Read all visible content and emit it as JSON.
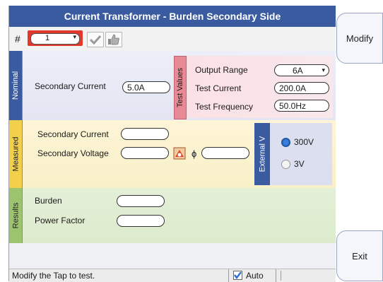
{
  "window": {
    "title": "Current Transformer - Burden Secondary Side"
  },
  "toolbar": {
    "hash_label": "#",
    "tap_value": "1",
    "tap_dropdown_glyph": "▾",
    "check_icon": "check-icon",
    "thumb_icon": "thumbs-up-icon"
  },
  "nominal": {
    "tab_label": "Nominal",
    "secondary_current_label": "Secondary Current",
    "secondary_current_value": "5.0A",
    "test_values": {
      "tab_label": "Test Values",
      "output_range_label": "Output Range",
      "output_range_value": "6A",
      "test_current_label": "Test Current",
      "test_current_value": "200.0A",
      "test_frequency_label": "Test Frequency",
      "test_frequency_value": "50.0Hz"
    }
  },
  "measured": {
    "tab_label": "Measured",
    "secondary_current_label": "Secondary Current",
    "secondary_current_value": "",
    "secondary_voltage_label": "Secondary Voltage",
    "secondary_voltage_value": "",
    "phi_symbol": "ϕ",
    "phi_value": "",
    "external_v": {
      "tab_label": "External V",
      "opt1": "300V",
      "opt2": "3V",
      "selected": "300V"
    }
  },
  "results": {
    "tab_label": "Results",
    "burden_label": "Burden",
    "burden_value": "",
    "power_factor_label": "Power Factor",
    "power_factor_value": ""
  },
  "status": {
    "message": "Modify the Tap to test.",
    "auto_label": "Auto",
    "auto_checked": true
  },
  "side": {
    "modify_label": "Modify",
    "exit_label": "Exit"
  },
  "colors": {
    "title_bar": "#3a5ba0",
    "tap_highlight": "#e0392c",
    "measured_tab": "#f2d04c",
    "results_tab": "#9cc46e",
    "test_values_tab": "#e88a96"
  }
}
